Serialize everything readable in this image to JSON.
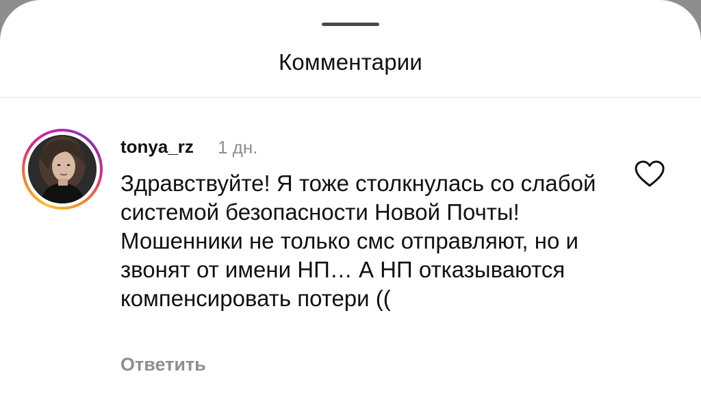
{
  "sheet": {
    "title": "Комментарии"
  },
  "comment": {
    "username": "tonya_rz",
    "timestamp": "1 дн.",
    "text": "Здравствуйте! Я тоже столкнулась со слабой системой безопасности Новой Почты! Мошенники не только смс отправляют, но и звонят от имени НП… А НП отказываются компенсировать потери ((",
    "reply_label": "Ответить",
    "like_icon": "heart-outline-icon"
  },
  "colors": {
    "text_primary": "#111111",
    "text_secondary": "#8e8e8e",
    "divider": "#e4e4e4",
    "story_ring": [
      "#f9c229",
      "#f58529",
      "#dd2a7b",
      "#8134af"
    ]
  }
}
